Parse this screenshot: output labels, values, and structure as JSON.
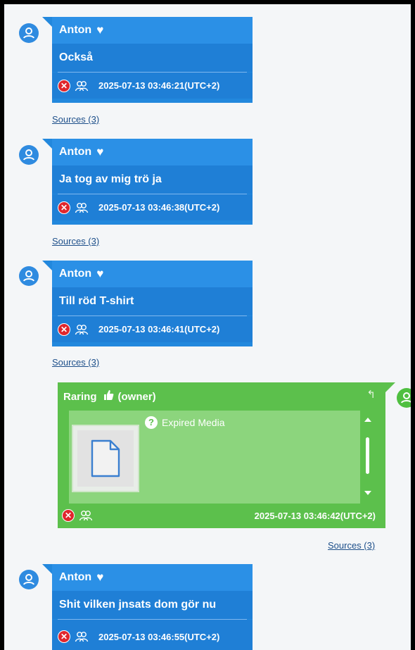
{
  "messages": [
    {
      "author": "Anton",
      "text": "Också",
      "timestamp": "2025-07-13 03:46:21(UTC+2)",
      "sources": "Sources (3)"
    },
    {
      "author": "Anton",
      "text": "Ja tog av mig trö ja",
      "timestamp": "2025-07-13 03:46:38(UTC+2)",
      "sources": "Sources (3)"
    },
    {
      "author": "Anton",
      "text": "Till röd T-shirt",
      "timestamp": "2025-07-13 03:46:41(UTC+2)",
      "sources": "Sources (3)"
    },
    {
      "author": "Anton",
      "text": "Shit vilken jnsats dom gör nu",
      "timestamp": "2025-07-13 03:46:55(UTC+2)",
      "sources": ""
    }
  ],
  "owner_message": {
    "author": "Raring",
    "role": "(owner)",
    "media_status": "Expired Media",
    "timestamp": "2025-07-13 03:46:42(UTC+2)",
    "sources": "Sources (3)"
  },
  "colors": {
    "incoming": "#2288dd",
    "outgoing": "#5cc04c",
    "delete": "#e0262c"
  },
  "icons": {
    "heart": "heart-icon",
    "owner": "thumbs-up-icon",
    "reply": "reply-icon",
    "delete": "delete-icon",
    "participants": "people-icon"
  }
}
